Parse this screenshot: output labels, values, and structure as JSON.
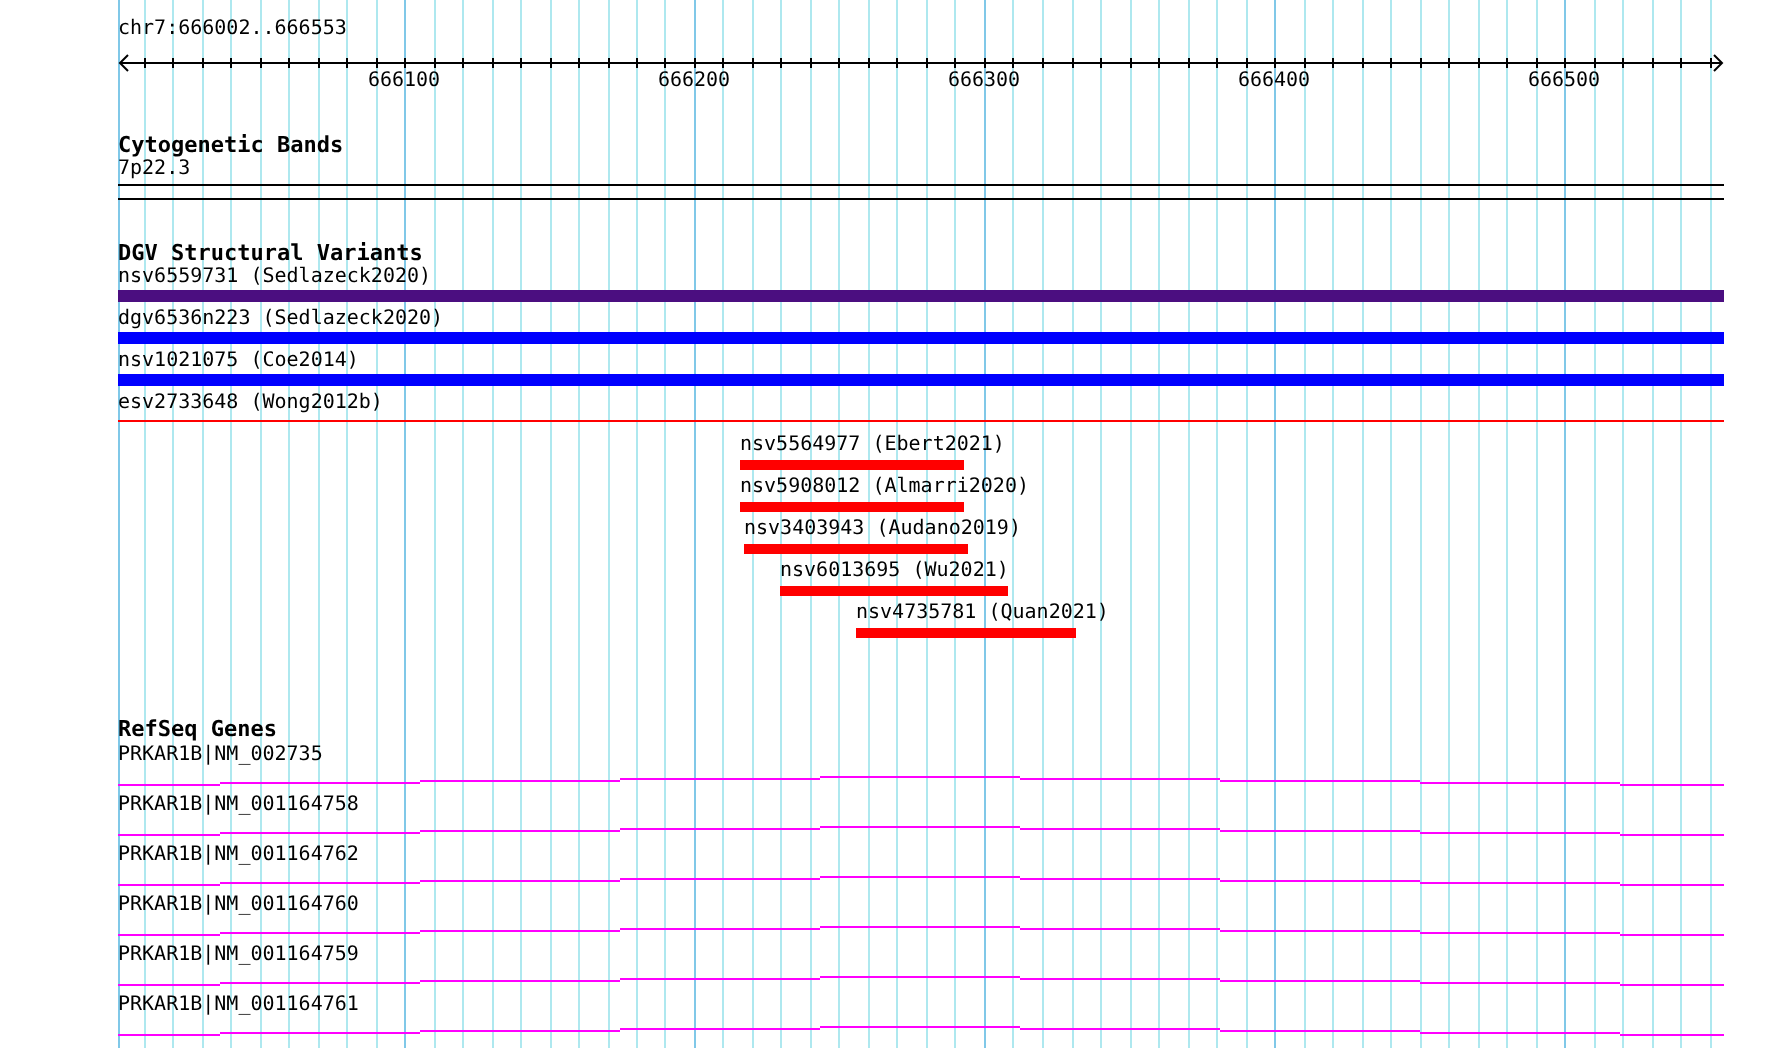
{
  "location": "chr7:666002..666553",
  "ruler": {
    "labels": [
      "666100",
      "666200",
      "666300",
      "666400",
      "666500"
    ]
  },
  "tracks": [
    {
      "kind": "bands",
      "title": "Cytogenetic Bands",
      "items": [
        {
          "label": "7p22.3"
        }
      ]
    },
    {
      "kind": "variants",
      "title": "DGV Structural Variants",
      "items": [
        {
          "kind": "full",
          "label": "nsv6559731 (Sedlazeck2020)",
          "color": "#4b0e80"
        },
        {
          "kind": "full",
          "label": "dgv6536n223 (Sedlazeck2020)",
          "color": "#0000ff"
        },
        {
          "kind": "full",
          "label": "nsv1021075 (Coe2014)",
          "color": "#0000ff"
        },
        {
          "kind": "line",
          "label": "esv2733648 (Wong2012b)",
          "color": "#ff0000"
        },
        {
          "kind": "short",
          "label": "nsv5564977 (Ebert2021)",
          "color": "#ff0000"
        },
        {
          "kind": "short",
          "label": "nsv5908012 (Almarri2020)",
          "color": "#ff0000"
        },
        {
          "kind": "short",
          "label": "nsv3403943 (Audano2019)",
          "color": "#ff0000"
        },
        {
          "kind": "short",
          "label": "nsv6013695 (Wu2021)",
          "color": "#ff0000"
        },
        {
          "kind": "short",
          "label": "nsv4735781 (Quan2021)",
          "color": "#ff0000"
        }
      ]
    },
    {
      "kind": "genes",
      "title": "RefSeq Genes",
      "items": [
        {
          "label": "PRKAR1B|NM_002735"
        },
        {
          "label": "PRKAR1B|NM_001164758"
        },
        {
          "label": "PRKAR1B|NM_001164762"
        },
        {
          "label": "PRKAR1B|NM_001164760"
        },
        {
          "label": "PRKAR1B|NM_001164759"
        },
        {
          "label": "PRKAR1B|NM_001164761"
        }
      ]
    }
  ]
}
